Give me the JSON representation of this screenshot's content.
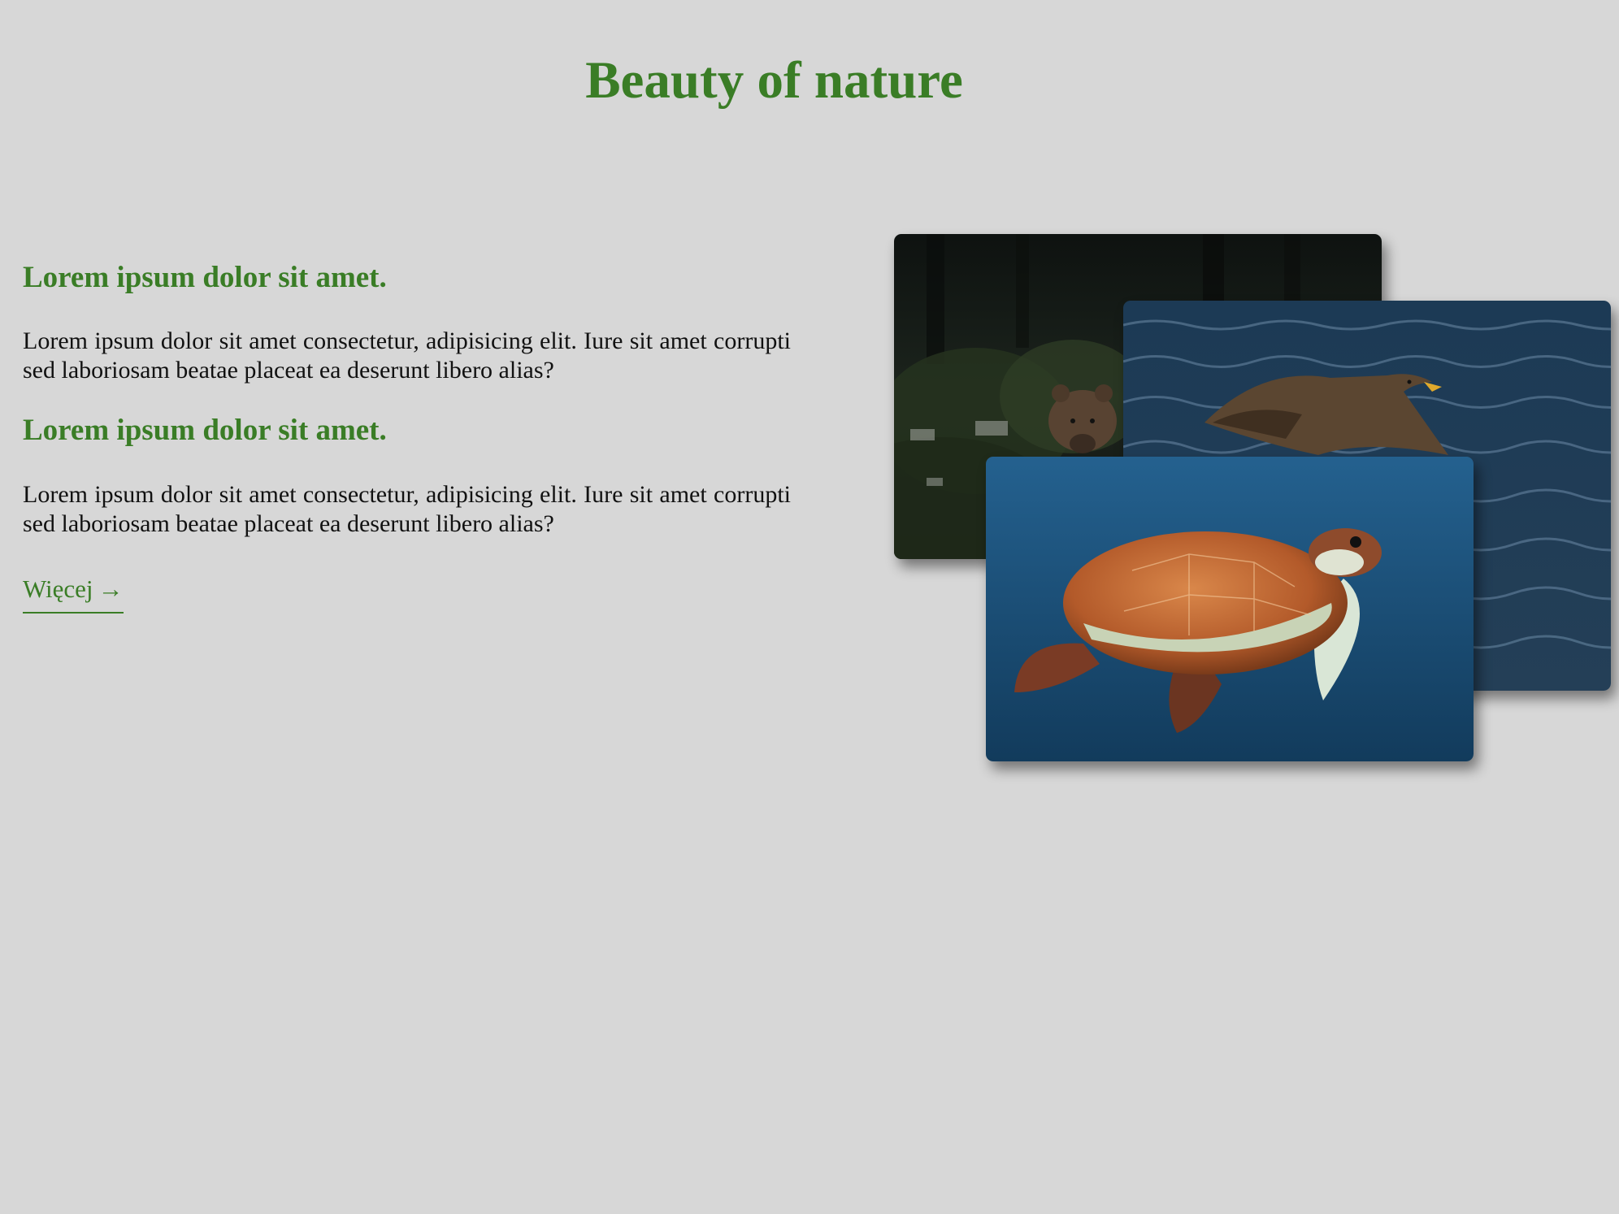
{
  "page": {
    "title": "Beauty of nature"
  },
  "sections": [
    {
      "heading": "Lorem ipsum dolor sit amet.",
      "body": "Lorem ipsum dolor sit amet consectetur, adipisicing elit. Iure sit amet corrupti sed laboriosam beatae placeat ea deserunt libero alias?"
    },
    {
      "heading": "Lorem ipsum dolor sit amet.",
      "body": "Lorem ipsum dolor sit amet consectetur, adipisicing elit. Iure sit amet corrupti sed laboriosam beatae placeat ea deserunt libero alias?"
    }
  ],
  "link": {
    "label": "Więcej",
    "arrow": "→"
  },
  "photos": [
    {
      "subject": "bear-in-forest"
    },
    {
      "subject": "eagle-over-water"
    },
    {
      "subject": "sea-turtle-underwater"
    }
  ],
  "colors": {
    "accent": "#3a7d26",
    "background": "#d7d7d7",
    "text": "#111111"
  }
}
